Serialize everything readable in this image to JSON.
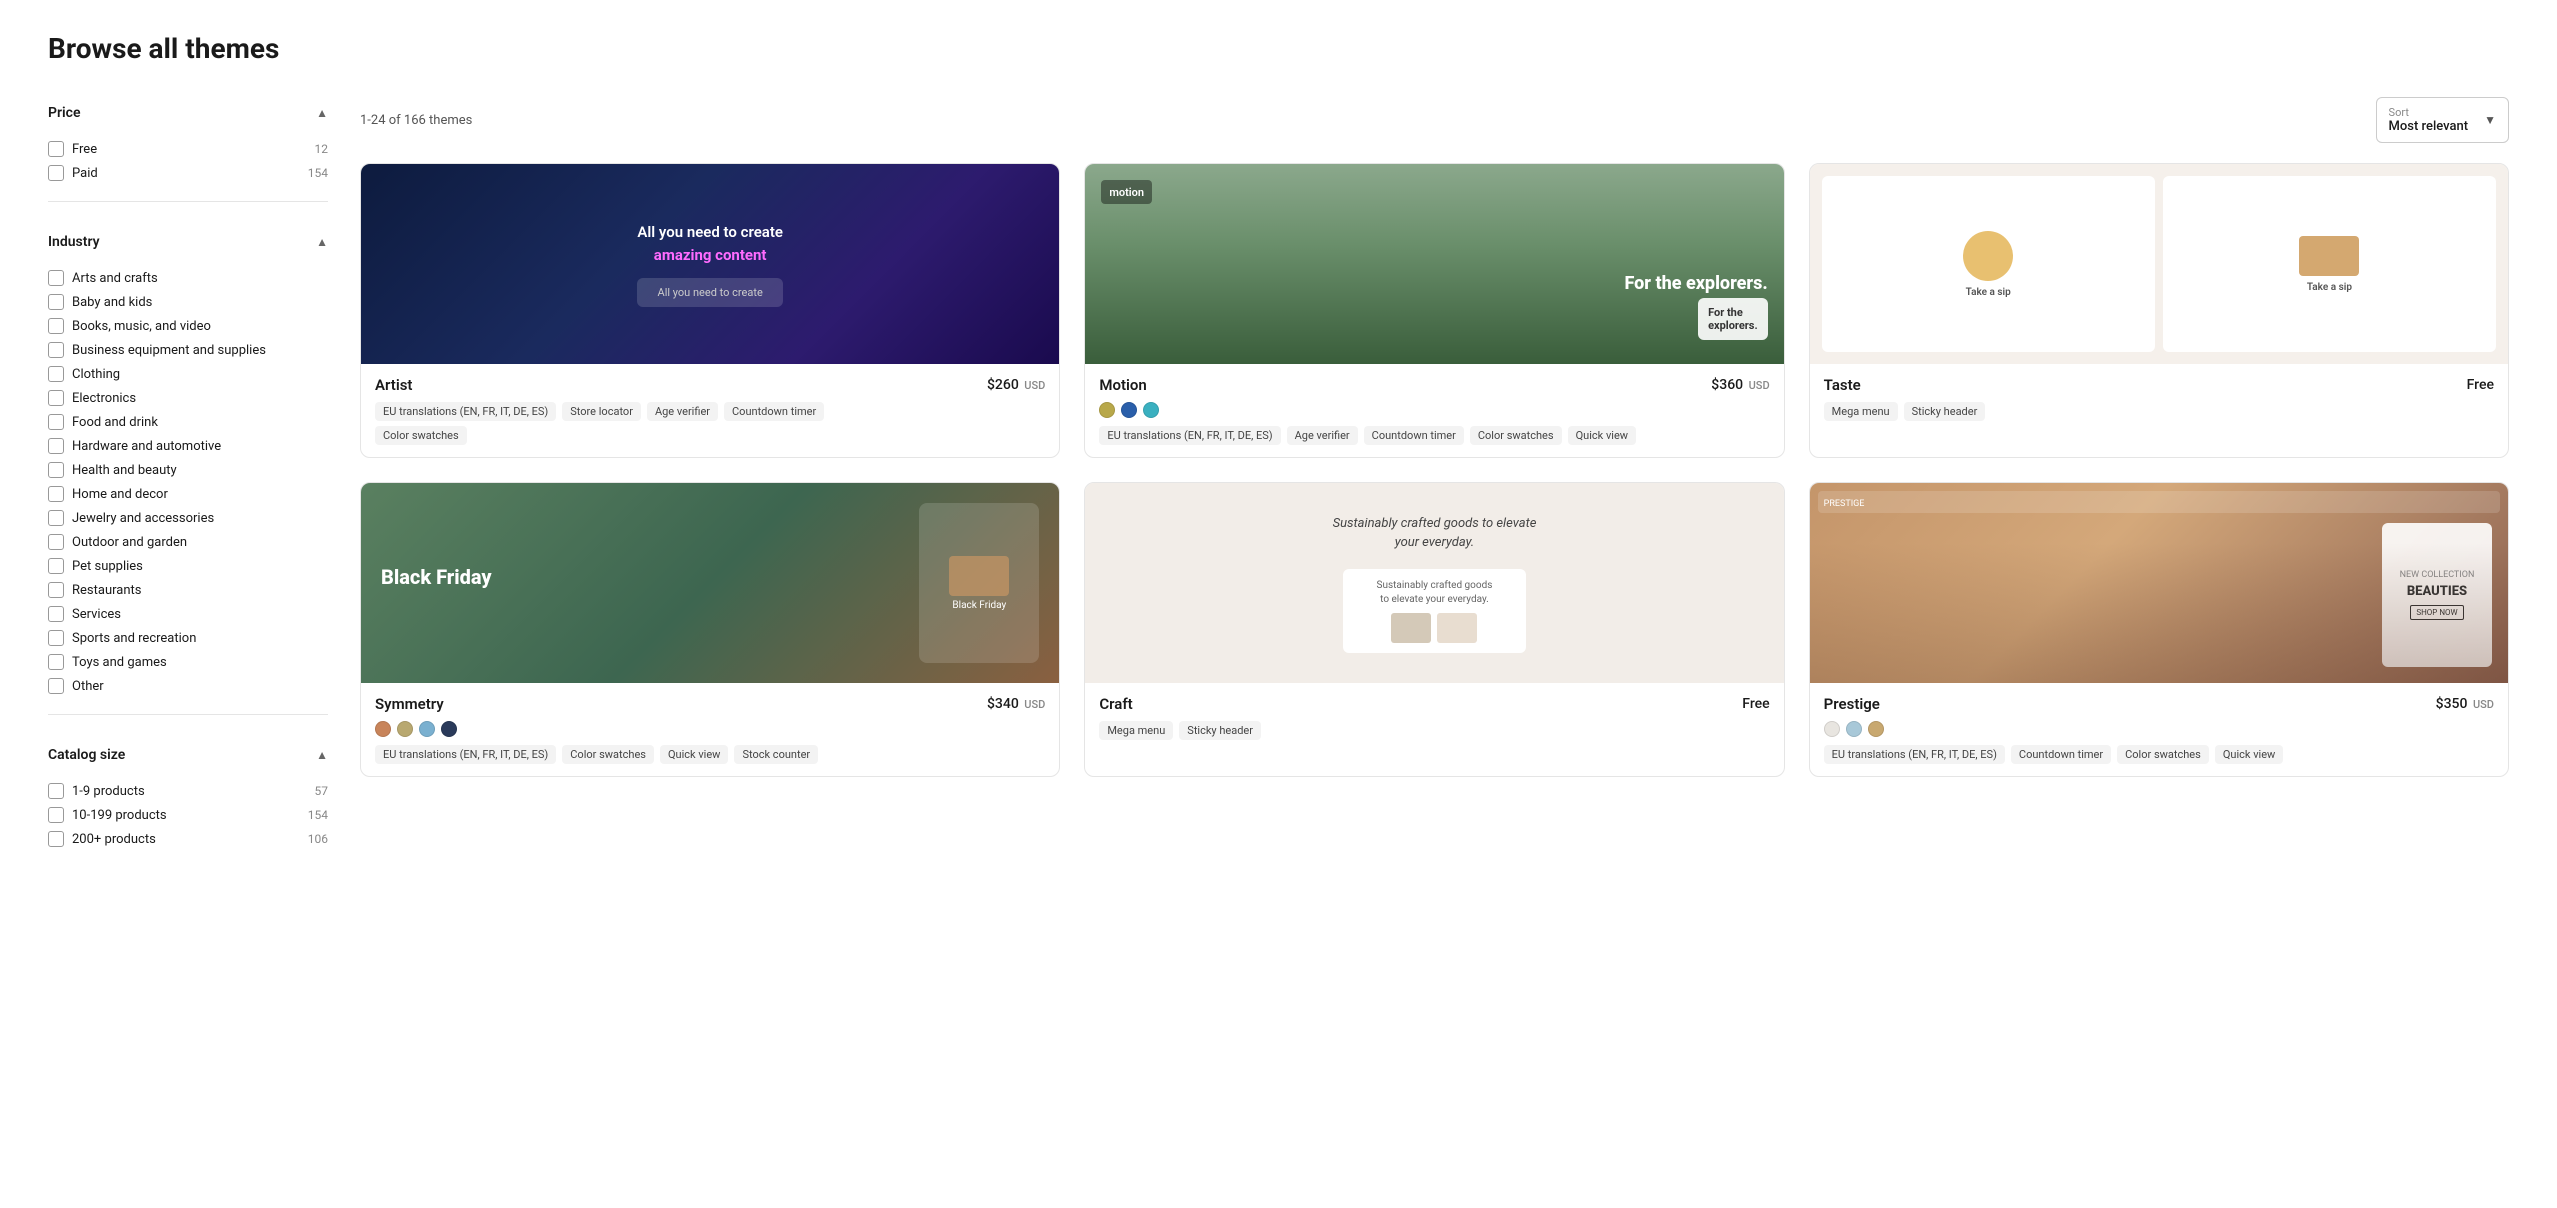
{
  "page": {
    "title": "Browse all themes"
  },
  "sidebar": {
    "price_section": {
      "label": "Price",
      "items": [
        {
          "label": "Free",
          "count": "12"
        },
        {
          "label": "Paid",
          "count": "154"
        }
      ]
    },
    "industry_section": {
      "label": "Industry",
      "items": [
        {
          "label": "Arts and crafts",
          "count": ""
        },
        {
          "label": "Baby and kids",
          "count": ""
        },
        {
          "label": "Books, music, and video",
          "count": ""
        },
        {
          "label": "Business equipment and supplies",
          "count": ""
        },
        {
          "label": "Clothing",
          "count": ""
        },
        {
          "label": "Electronics",
          "count": ""
        },
        {
          "label": "Food and drink",
          "count": ""
        },
        {
          "label": "Hardware and automotive",
          "count": ""
        },
        {
          "label": "Health and beauty",
          "count": ""
        },
        {
          "label": "Home and decor",
          "count": ""
        },
        {
          "label": "Jewelry and accessories",
          "count": ""
        },
        {
          "label": "Outdoor and garden",
          "count": ""
        },
        {
          "label": "Pet supplies",
          "count": ""
        },
        {
          "label": "Restaurants",
          "count": ""
        },
        {
          "label": "Services",
          "count": ""
        },
        {
          "label": "Sports and recreation",
          "count": ""
        },
        {
          "label": "Toys and games",
          "count": ""
        },
        {
          "label": "Other",
          "count": ""
        }
      ]
    },
    "catalog_section": {
      "label": "Catalog size",
      "items": [
        {
          "label": "1-9 products",
          "count": "57"
        },
        {
          "label": "10-199 products",
          "count": "154"
        },
        {
          "label": "200+ products",
          "count": "106"
        }
      ]
    }
  },
  "results": {
    "count_text": "1-24 of 166 themes",
    "sort_label": "Sort",
    "sort_value": "Most relevant"
  },
  "themes": [
    {
      "name": "Artist",
      "price": "$260",
      "currency": "USD",
      "is_free": false,
      "tags": [
        "EU translations (EN, FR, IT, DE, ES)",
        "Store locator",
        "Age verifier",
        "Countdown timer",
        "Color swatches"
      ],
      "colors": []
    },
    {
      "name": "Motion",
      "price": "$360",
      "currency": "USD",
      "is_free": false,
      "tags": [
        "EU translations (EN, FR, IT, DE, ES)",
        "Age verifier",
        "Countdown timer",
        "Color swatches",
        "Quick view"
      ],
      "colors": [
        "#b8a84a",
        "#2a5faa",
        "#3ab0c0"
      ]
    },
    {
      "name": "Taste",
      "price": "Free",
      "currency": "",
      "is_free": true,
      "tags": [
        "Mega menu",
        "Sticky header"
      ],
      "colors": []
    },
    {
      "name": "Symmetry",
      "price": "$340",
      "currency": "USD",
      "is_free": false,
      "tags": [
        "EU translations (EN, FR, IT, DE, ES)",
        "Color swatches",
        "Quick view",
        "Stock counter"
      ],
      "colors": [
        "#c8845a",
        "#b8a870",
        "#7ab0d0",
        "#2a3a5a"
      ]
    },
    {
      "name": "Craft",
      "price": "Free",
      "currency": "",
      "is_free": true,
      "tags": [
        "Mega menu",
        "Sticky header"
      ],
      "colors": []
    },
    {
      "name": "Prestige",
      "price": "$350",
      "currency": "USD",
      "is_free": false,
      "tags": [
        "EU translations (EN, FR, IT, DE, ES)",
        "Countdown timer",
        "Color swatches",
        "Quick view"
      ],
      "colors": [
        "#e8e5e0",
        "#a8c8d8",
        "#c8a870"
      ]
    }
  ]
}
